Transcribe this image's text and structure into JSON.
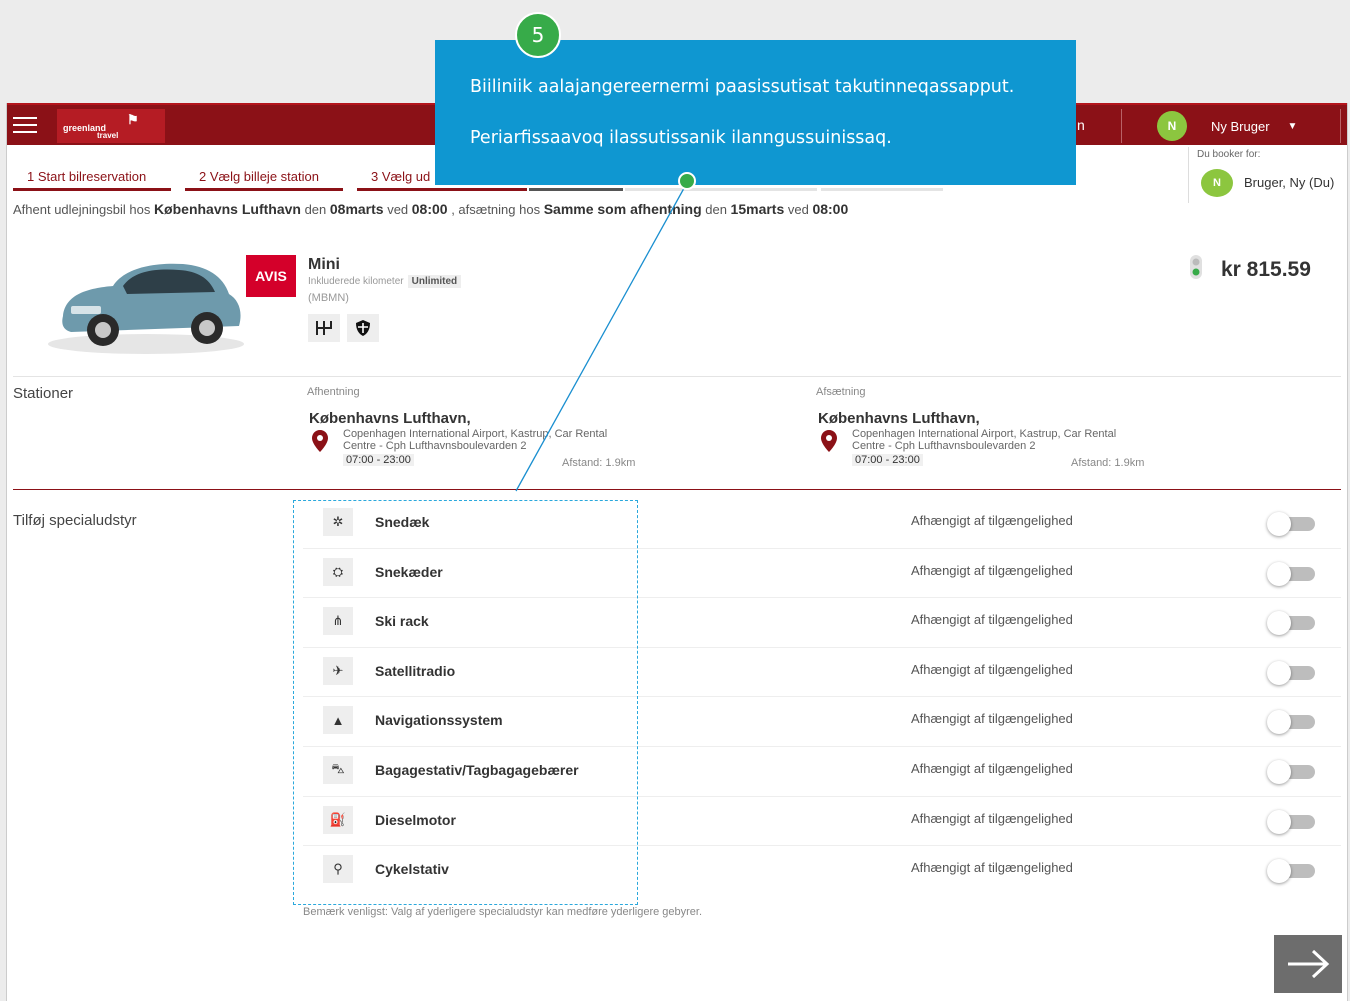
{
  "topbar": {
    "partial_text": "n",
    "user_initial": "N",
    "user_name": "Ny Bruger"
  },
  "logo": {
    "line1": "greenland",
    "line2": "travel"
  },
  "steps": [
    {
      "label": "1  Start bilreservation"
    },
    {
      "label": "2  Vælg billeje station"
    },
    {
      "label": "3  Vælg ud"
    }
  ],
  "booker": {
    "label": "Du booker for:",
    "initial": "N",
    "name": "Bruger, Ny (Du)"
  },
  "summary": {
    "p1": "Afhent udlejningsbil hos ",
    "pickup_station": "Københavns Lufthavn",
    "p2": " den ",
    "pickup_date": "08marts",
    "p3": " ved ",
    "pickup_time": "08:00",
    "p4": " , afsætning hos ",
    "dropoff_station": "Samme som afhentning",
    "p5": " den ",
    "dropoff_date": "15marts",
    "p6": " ved ",
    "dropoff_time": "08:00"
  },
  "car": {
    "vendor": "AVIS",
    "name": "Mini",
    "km_label": "Inkluderede kilometer",
    "km_value": "Unlimited",
    "code": "(MBMN)",
    "price": "kr 815.59",
    "features": [
      "gearbox-icon",
      "shield-icon"
    ]
  },
  "stations": {
    "label": "Stationer",
    "pickup": {
      "caption": "Afhentning",
      "name": "Københavns Lufthavn,",
      "addr1": "Copenhagen International Airport, Kastrup, Car Rental",
      "addr2": "Centre - Cph Lufthavnsboulevarden 2",
      "hours": "07:00 - 23:00",
      "distance": "Afstand: 1.9km"
    },
    "dropoff": {
      "caption": "Afsætning",
      "name": "Københavns Lufthavn,",
      "addr1": "Copenhagen International Airport, Kastrup, Car Rental",
      "addr2": "Centre - Cph Lufthavnsboulevarden 2",
      "hours": "07:00 - 23:00",
      "distance": "Afstand: 1.9km"
    }
  },
  "equipment": {
    "label": "Tilføj specialudstyr",
    "availability": "Afhængigt af tilgængelighed",
    "items": [
      {
        "name": "Snedæk",
        "icon": "tire-icon",
        "glyph": "✲",
        "enabled": false
      },
      {
        "name": "Snekæder",
        "icon": "chain-icon",
        "glyph": "⛭",
        "enabled": false
      },
      {
        "name": "Ski rack",
        "icon": "ski-rack-icon",
        "glyph": "⋔",
        "enabled": false
      },
      {
        "name": "Satellitradio",
        "icon": "satellite-icon",
        "glyph": "✈",
        "enabled": false
      },
      {
        "name": "Navigationssystem",
        "icon": "navigation-icon",
        "glyph": "▲",
        "enabled": false
      },
      {
        "name": "Bagagestativ/Tagbagagebærer",
        "icon": "roof-rack-icon",
        "glyph": "⛍",
        "enabled": false
      },
      {
        "name": "Dieselmotor",
        "icon": "fuel-pump-icon",
        "glyph": "⛽",
        "enabled": false
      },
      {
        "name": "Cykelstativ",
        "icon": "bicycle-icon",
        "glyph": "⚲",
        "enabled": false
      }
    ],
    "note": "Bemærk venligst: Valg af yderligere specialudstyr kan medføre yderligere gebyrer."
  },
  "callout": {
    "step_number": "5",
    "line1": "Biiliniik aalajangereernermi paasissutisat takutinneqassapput.",
    "line2": "Periarfissaavoq ilassutissanik ilanngussuinissaq."
  },
  "colors": {
    "brand": "#8b1117",
    "callout": "#0f97d1",
    "step_badge": "#37ab49",
    "avatar": "#8cc63f"
  }
}
